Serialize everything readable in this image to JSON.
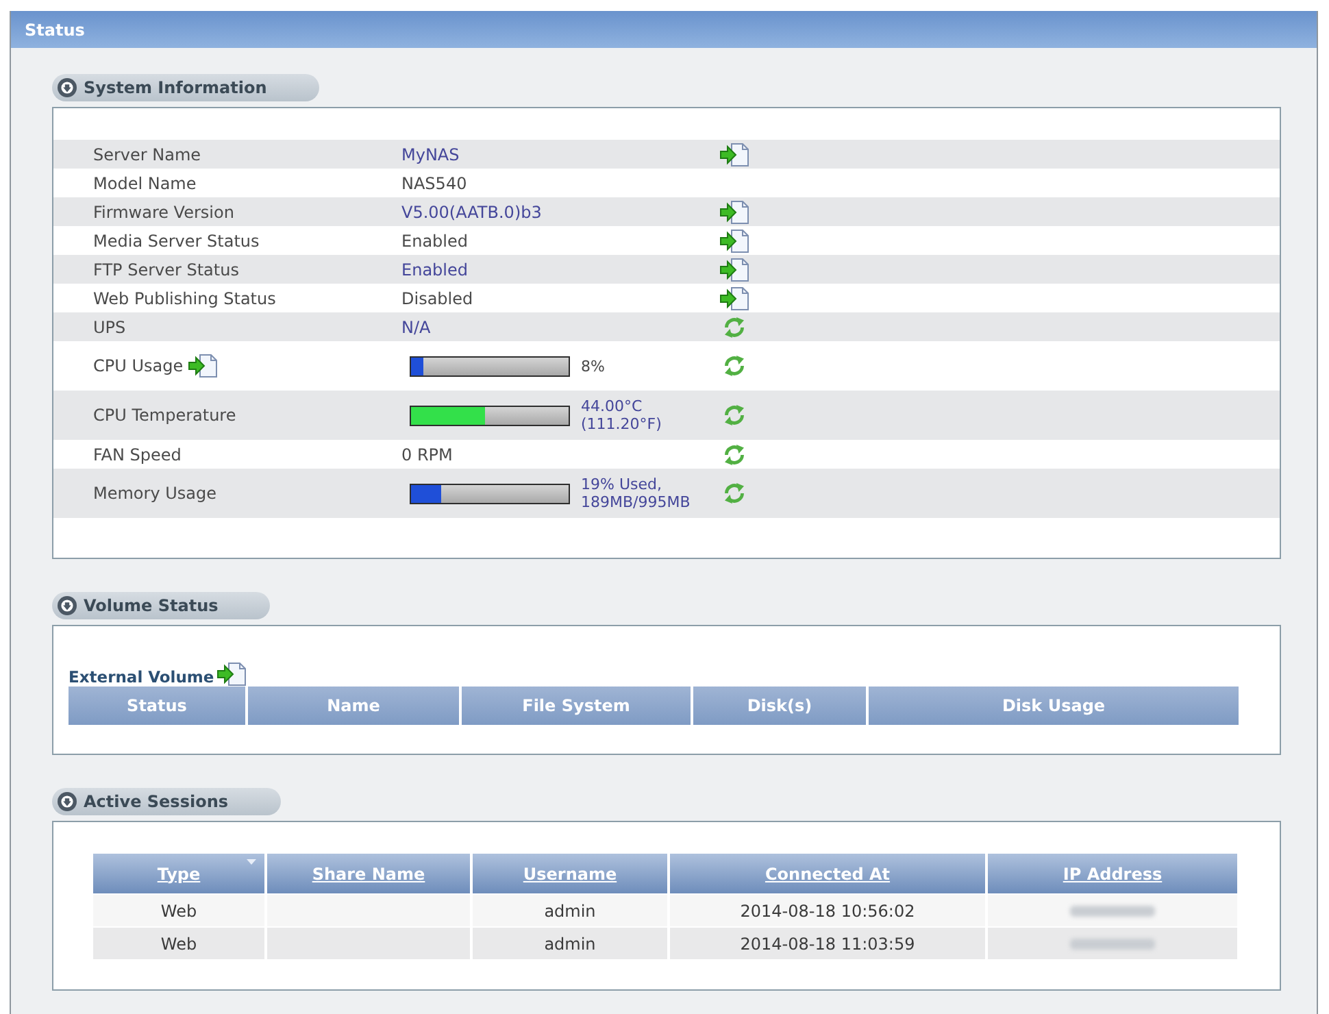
{
  "header": {
    "title": "Status"
  },
  "system_information": {
    "title": "System Information",
    "rows": [
      {
        "kind": "text",
        "label": "Server Name",
        "label_link": false,
        "value": "MyNAS",
        "linked": true,
        "refreshable": false
      },
      {
        "kind": "text",
        "label": "Model Name",
        "label_link": false,
        "value": "NAS540",
        "linked": false,
        "refreshable": false
      },
      {
        "kind": "text",
        "label": "Firmware Version",
        "label_link": false,
        "value": "V5.00(AATB.0)b3",
        "linked": true,
        "refreshable": false
      },
      {
        "kind": "text",
        "label": "Media Server Status",
        "label_link": false,
        "value": "Enabled",
        "linked": true,
        "refreshable": false
      },
      {
        "kind": "text",
        "label": "FTP Server Status",
        "label_link": false,
        "value": "Enabled",
        "linked": true,
        "refreshable": false
      },
      {
        "kind": "text",
        "label": "Web Publishing Status",
        "label_link": false,
        "value": "Disabled",
        "linked": true,
        "refreshable": false
      },
      {
        "kind": "text",
        "label": "UPS",
        "label_link": false,
        "value": "N/A",
        "linked": false,
        "refreshable": true
      },
      {
        "kind": "meter",
        "label": "CPU Usage",
        "label_link": true,
        "level": 0.08,
        "color": "#1f4fd8",
        "reading": "8%",
        "linked": false,
        "refreshable": true
      },
      {
        "kind": "meter",
        "label": "CPU Temperature",
        "label_link": false,
        "level": 0.47,
        "color": "#33e04a",
        "reading": "44.00°C (111.20°F)",
        "linked": false,
        "refreshable": true
      },
      {
        "kind": "text",
        "label": "FAN Speed",
        "label_link": false,
        "value": "0 RPM",
        "linked": false,
        "refreshable": true
      },
      {
        "kind": "meter",
        "label": "Memory Usage",
        "label_link": false,
        "level": 0.19,
        "color": "#1f4fd8",
        "reading": "19% Used, 189MB/995MB",
        "linked": false,
        "refreshable": true
      }
    ]
  },
  "volume_status": {
    "title": "Volume Status",
    "subtitle": "External Volume",
    "columns": [
      "Status",
      "Name",
      "File System",
      "Disk(s)",
      "Disk Usage"
    ]
  },
  "active_sessions": {
    "title": "Active Sessions",
    "columns": [
      {
        "label": "Type",
        "sorted": true
      },
      {
        "label": "Share Name",
        "sorted": false
      },
      {
        "label": "Username",
        "sorted": false
      },
      {
        "label": "Connected At",
        "sorted": false
      },
      {
        "label": "IP Address",
        "sorted": false
      }
    ],
    "rows": [
      {
        "type": "Web",
        "username": "admin",
        "connected_at": "2014-08-18 10:56:02"
      },
      {
        "type": "Web",
        "username": "admin",
        "connected_at": "2014-08-18 11:03:59"
      }
    ]
  }
}
